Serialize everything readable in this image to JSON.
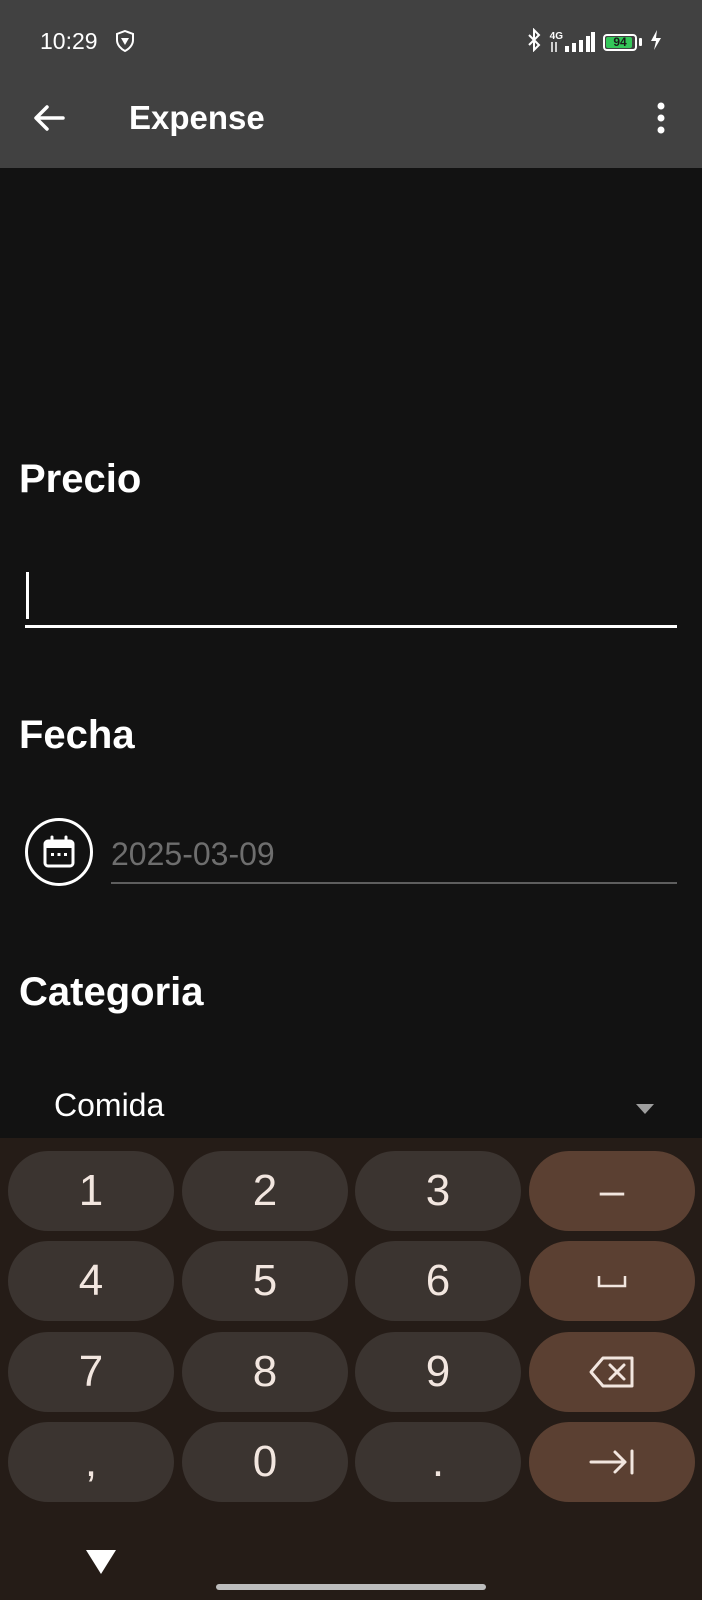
{
  "status_bar": {
    "time": "10:29",
    "network": "4G",
    "battery": "94",
    "battery_level": 0.94
  },
  "app_bar": {
    "title": "Expense",
    "back_icon": "arrow-left-icon",
    "menu_icon": "more-vert-icon"
  },
  "form": {
    "price_label": "Precio",
    "price_value": "",
    "date_label": "Fecha",
    "date_value": "2025-03-09",
    "category_label": "Categoria",
    "category_value": "Comida"
  },
  "keyboard": {
    "keys": [
      "1",
      "2",
      "3",
      "–",
      "4",
      "5",
      "6",
      "␣",
      "7",
      "8",
      "9",
      "backspace",
      ",",
      "0",
      ".",
      "→|"
    ]
  },
  "colors": {
    "app_bar": "#414141",
    "background": "#121212",
    "keyboard_bg": "#251c17",
    "key": "#3b3430",
    "function_key": "#5b4032"
  }
}
